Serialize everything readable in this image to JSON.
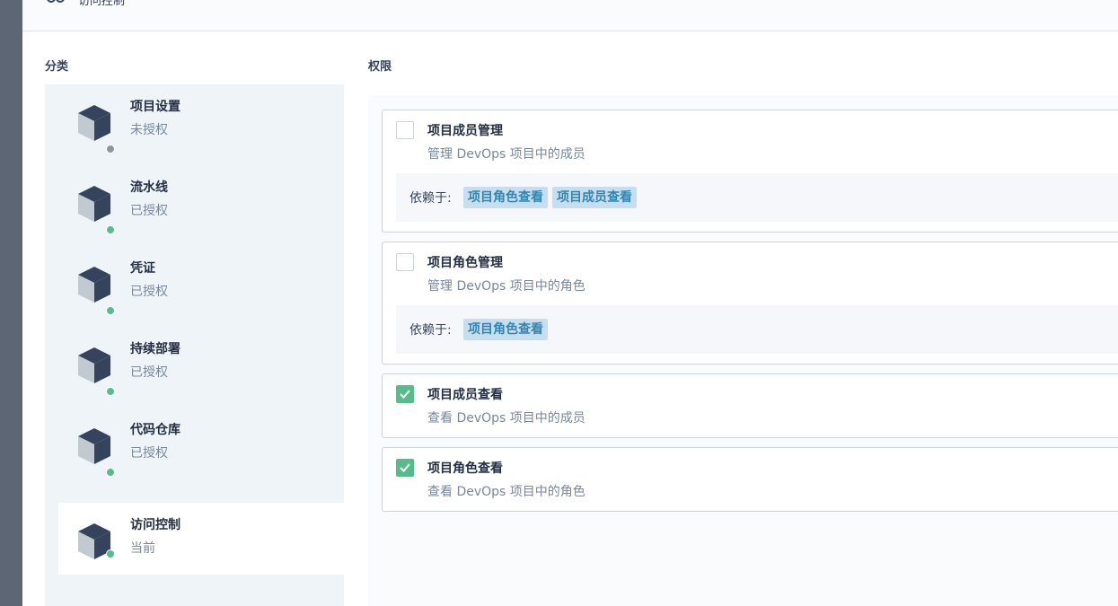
{
  "header": {
    "title": "访问控制"
  },
  "categories_label": "分类",
  "permissions_label": "权限",
  "categories": [
    {
      "name": "项目设置",
      "status": "未授权",
      "dot": "#8c96a5"
    },
    {
      "name": "流水线",
      "status": "已授权",
      "dot": "#55bc8a"
    },
    {
      "name": "凭证",
      "status": "已授权",
      "dot": "#55bc8a"
    },
    {
      "name": "持续部署",
      "status": "已授权",
      "dot": "#55bc8a"
    },
    {
      "name": "代码仓库",
      "status": "已授权",
      "dot": "#55bc8a"
    },
    {
      "name": "访问控制",
      "status": "当前",
      "dot": "#55bc8a"
    }
  ],
  "permissions": [
    {
      "title": "项目成员管理",
      "desc": "管理 DevOps 项目中的成员",
      "checked": false,
      "depends_label": "依赖于:",
      "depends": [
        "项目角色查看",
        "项目成员查看"
      ]
    },
    {
      "title": "项目角色管理",
      "desc": "管理 DevOps 项目中的角色",
      "checked": false,
      "depends_label": "依赖于:",
      "depends": [
        "项目角色查看"
      ]
    },
    {
      "title": "项目成员查看",
      "desc": "查看 DevOps 项目中的成员",
      "checked": true
    },
    {
      "title": "项目角色查看",
      "desc": "查看 DevOps 项目中的角色",
      "checked": true
    }
  ],
  "colors": {
    "accent": "#55bc8a",
    "tag_bg": "#c7deef",
    "tag_text": "#3385b0"
  }
}
